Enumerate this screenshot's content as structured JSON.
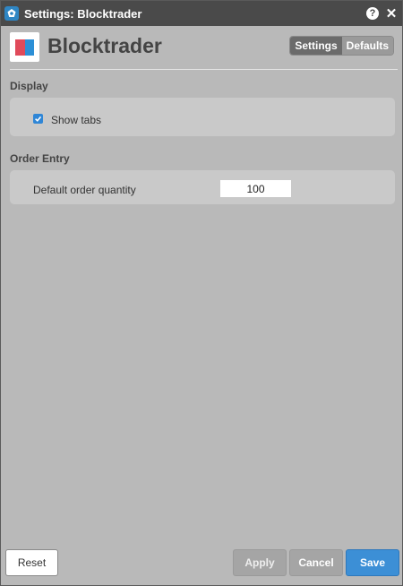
{
  "window": {
    "title": "Settings: Blocktrader",
    "icons": {
      "app": "app-icon",
      "help": "help-icon",
      "close": "close-icon"
    },
    "help_glyph": "?",
    "close_glyph": "✕"
  },
  "header": {
    "app_name": "Blocktrader",
    "tabs": [
      {
        "label": "Settings",
        "active": true
      },
      {
        "label": "Defaults",
        "active": false
      }
    ]
  },
  "sections": {
    "display": {
      "title": "Display",
      "show_tabs": {
        "label": "Show tabs",
        "checked": true
      }
    },
    "order_entry": {
      "title": "Order Entry",
      "default_qty": {
        "label": "Default order quantity",
        "value": "100"
      }
    }
  },
  "footer": {
    "reset": "Reset",
    "apply": "Apply",
    "cancel": "Cancel",
    "save": "Save"
  },
  "colors": {
    "accent": "#3c8fd6",
    "titlebar": "#4a4a4a",
    "logo_red": "#e04a5a",
    "logo_blue": "#2c8fd6"
  }
}
